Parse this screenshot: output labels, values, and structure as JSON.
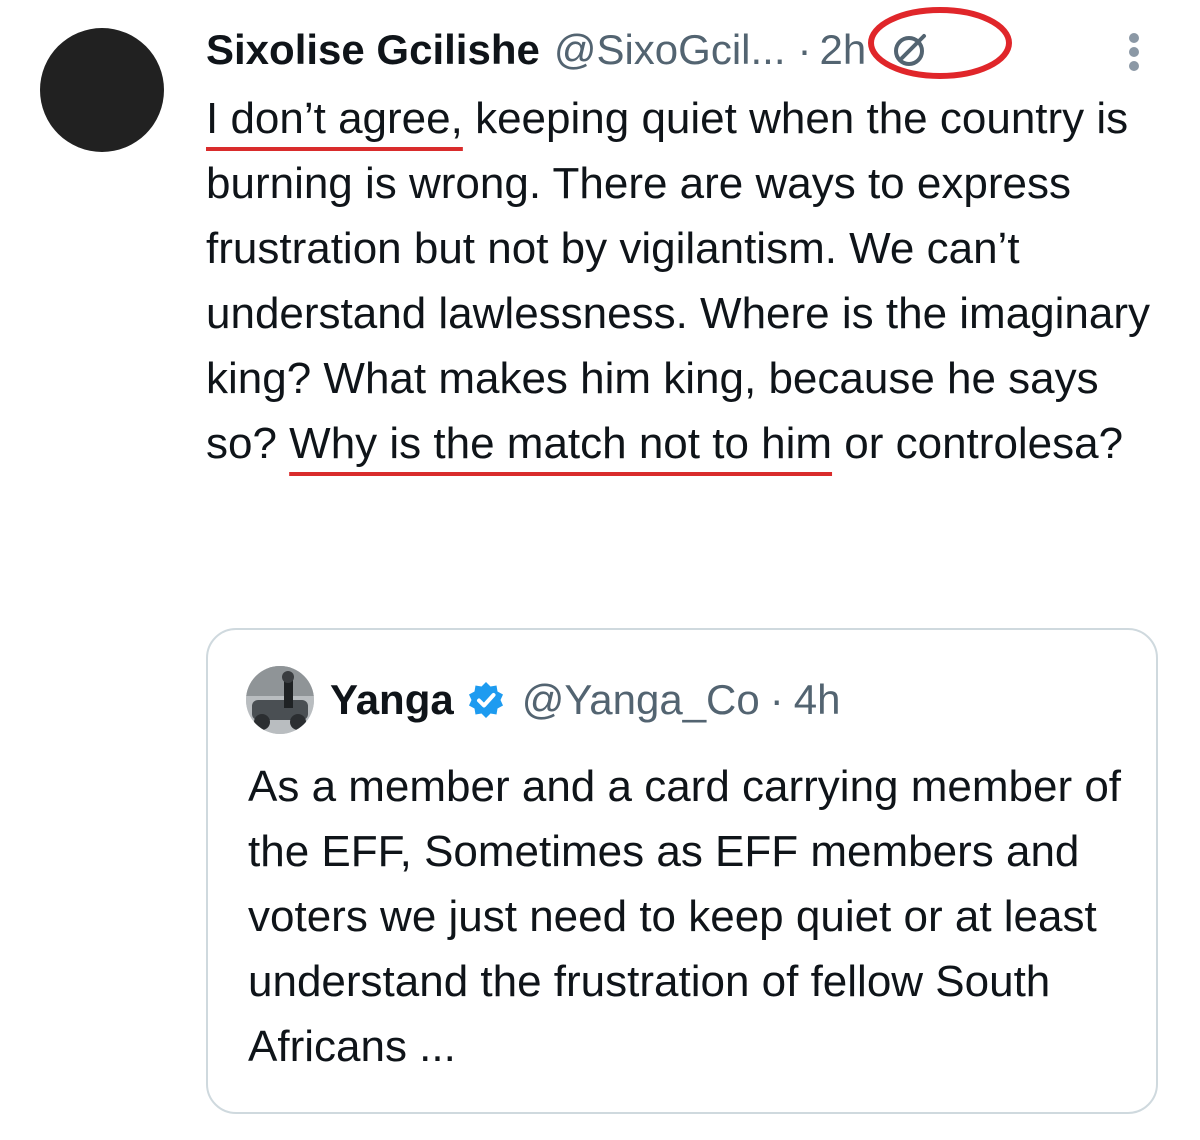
{
  "tweet": {
    "author_name": "Sixolise Gcilishe",
    "author_handle": "@SixoGcil...",
    "separator": "·",
    "time": "2h",
    "text_parts": [
      "I don’t agree,",
      " keeping quiet when the country is burning is wrong. There are ways to express frustration but not by vigilantism. We can’t understand lawlessness. Where is the imaginary king? What makes him king, because he says so? ",
      "Why is the match not to him",
      " or controlesa?"
    ],
    "icons": {
      "avatar": "avatar-placeholder",
      "grok": "grok-icon",
      "more": "more-vertical-icon"
    }
  },
  "quote": {
    "author_name": "Yanga",
    "author_handle": "@Yanga_Co",
    "separator": "·",
    "time": "4h",
    "text": "As a member and a card carrying member of the EFF, Sometimes as EFF members and voters we just need to keep quiet or at least understand the frustration of fellow South Africans ...",
    "icons": {
      "avatar": "photo-avatar",
      "verified": "verified-badge-icon"
    }
  },
  "colors": {
    "text": "#0f1419",
    "secondary": "#536471",
    "annotation_red": "#d92c2c",
    "verified_blue": "#1d9bf0",
    "border": "#cfd9de"
  }
}
